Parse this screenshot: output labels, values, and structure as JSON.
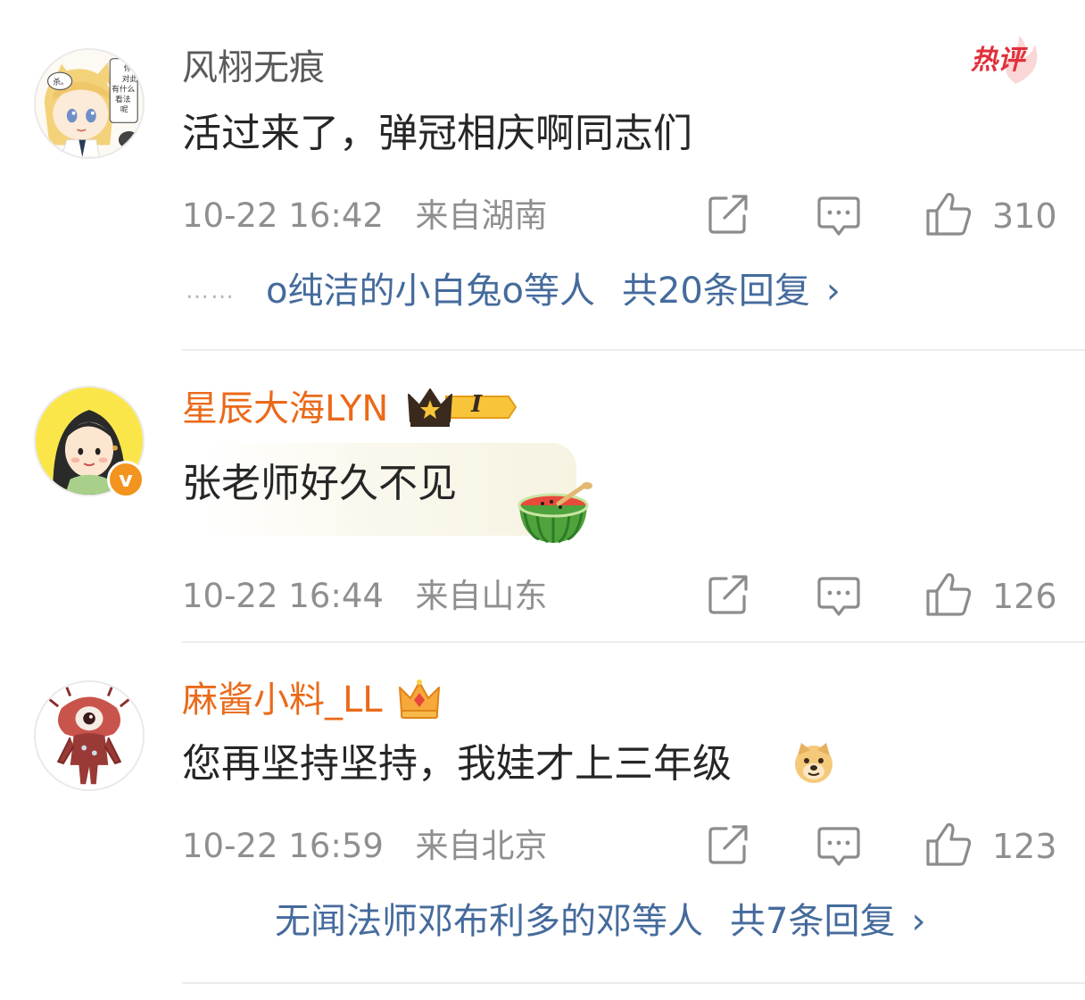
{
  "colors": {
    "link": "#456b9c",
    "vip_name": "#ea6a1a",
    "meta": "#8f8f8f",
    "hot_badge": "#e0313b"
  },
  "comments": [
    {
      "username": "风栩无痕",
      "text": "活过来了，弹冠相庆啊同志们",
      "time": "10-22 16:42",
      "location": "来自湖南",
      "likes": "310",
      "badge": "热评",
      "avatar_text": [
        "杀。",
        "你",
        "对此",
        "有什么",
        "看法",
        "呢"
      ],
      "replies": {
        "dots": "……",
        "users": "o纯洁的小白兔o等人",
        "count": "共20条回复",
        "chevron": "›"
      }
    },
    {
      "username": "星辰大海LYN",
      "text": "张老师好久不见",
      "time": "10-22 16:44",
      "location": "来自山东",
      "likes": "126",
      "vip_level": "I",
      "verified_mark": "v",
      "emoji": "watermelon-emoji"
    },
    {
      "username": "麻酱小料_LL",
      "text": "您再坚持坚持，我娃才上三年级",
      "time": "10-22 16:59",
      "location": "来自北京",
      "likes": "123",
      "emoji": "doge-emoji",
      "replies": {
        "users": "无闻法师邓布利多的邓等人",
        "count": "共7条回复",
        "chevron": "›"
      }
    }
  ],
  "icons": {
    "share": "share-icon",
    "comment": "comment-icon",
    "like": "like-icon"
  }
}
